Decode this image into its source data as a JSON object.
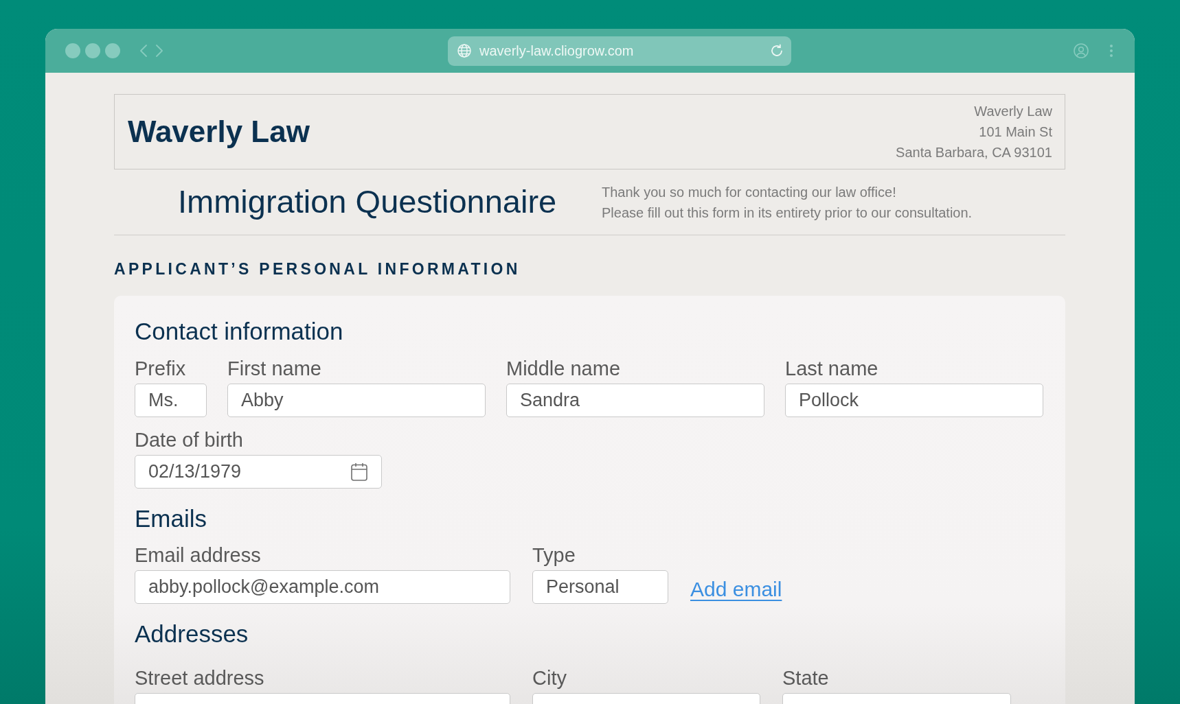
{
  "browser": {
    "url": "waverly-law.cliogrow.com"
  },
  "letterhead": {
    "firm_name": "Waverly Law",
    "address_lines": [
      "Waverly Law",
      "101 Main St",
      "Santa Barbara, CA 93101"
    ]
  },
  "title": "Immigration Questionnaire",
  "intro_lines": [
    "Thank you so much for contacting our law office!",
    "Please fill out this form in its entirety prior to our consultation."
  ],
  "section_title": "APPLICANT’S PERSONAL INFORMATION",
  "groups": [
    {
      "heading": "Contact information",
      "rows": [
        {
          "kind": "names",
          "items": [
            {
              "kind": "text",
              "label": "Prefix",
              "value": "Ms."
            },
            {
              "kind": "text",
              "label": "First name",
              "value": "Abby"
            },
            {
              "kind": "text",
              "label": "Middle name",
              "value": "Sandra"
            },
            {
              "kind": "text",
              "label": "Last name",
              "value": "Pollock"
            }
          ]
        },
        {
          "kind": "single",
          "items": [
            {
              "kind": "date",
              "label": "Date of birth",
              "value": "02/13/1979"
            }
          ]
        }
      ]
    },
    {
      "heading": "Emails",
      "rows": [
        {
          "kind": "email",
          "items": [
            {
              "kind": "text",
              "label": "Email address",
              "value": "abby.pollock@example.com"
            },
            {
              "kind": "text",
              "label": "Type",
              "value": "Personal"
            },
            {
              "kind": "link",
              "text": "Add email"
            }
          ]
        }
      ]
    },
    {
      "heading": "Addresses",
      "rows": [
        {
          "kind": "address",
          "items": [
            {
              "kind": "text",
              "label": "Street address"
            },
            {
              "kind": "text",
              "label": "City"
            },
            {
              "kind": "text",
              "label": "State"
            }
          ]
        }
      ]
    }
  ]
}
